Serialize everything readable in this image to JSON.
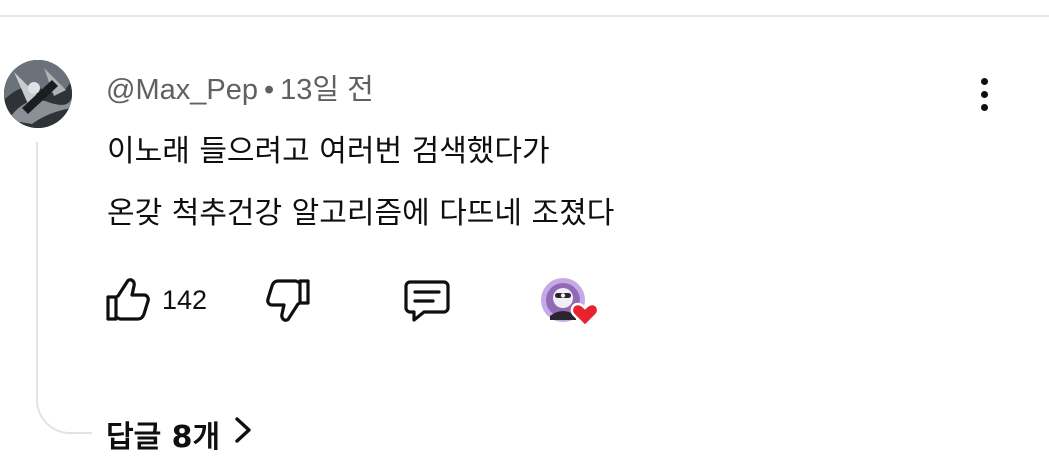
{
  "comment": {
    "author": "@Max_Pep",
    "separator": "•",
    "time": "13일 전",
    "lines": [
      "이노래 들으려고 여러번 검색했다가",
      "온갖 척추건강 알고리즘에 다뜨네 조졌다"
    ],
    "like_count": "142",
    "replies_label": "답글 8개"
  },
  "icons": {
    "more": "more-vert-icon",
    "like": "thumbs-up-icon",
    "dislike": "thumbs-down-icon",
    "reply": "comment-icon",
    "creator_heart": "creator-heart-icon",
    "replies_chevron": "chevron-right-icon"
  },
  "colors": {
    "heart": "#e8232f",
    "meta": "#606060",
    "text": "#0f0f0f"
  }
}
